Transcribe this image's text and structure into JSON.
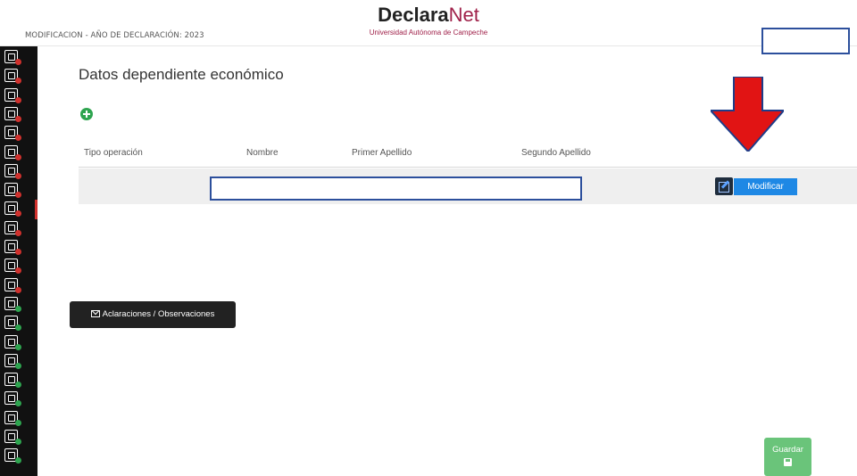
{
  "header": {
    "mode_label": "MODIFICACION - AÑO DE DECLARACIÓN: 2023",
    "brand_bold": "Declara",
    "brand_light": "Net",
    "brand_subtitle": "Universidad Autónoma de Campeche"
  },
  "sidebar": {
    "icon_count": 22,
    "active_index": 8
  },
  "main": {
    "section_title": "Datos dependiente económico",
    "add_icon": "plus-circle-icon",
    "table": {
      "headers": [
        "Tipo operación",
        "Nombre",
        "Primer Apellido",
        "Segundo Apellido"
      ],
      "row": {
        "modify_label": "Modificar"
      }
    },
    "clarifications_label": "Aclaraciones / Observaciones",
    "save_label": "Guardar"
  },
  "annotation": {
    "arrow_color": "#e11414"
  },
  "colors": {
    "brand": "#a0224a",
    "modify_button": "#1e88e5",
    "save_button": "#6ac47a",
    "add_button": "#2ea44f",
    "sidebar": "#111111"
  }
}
